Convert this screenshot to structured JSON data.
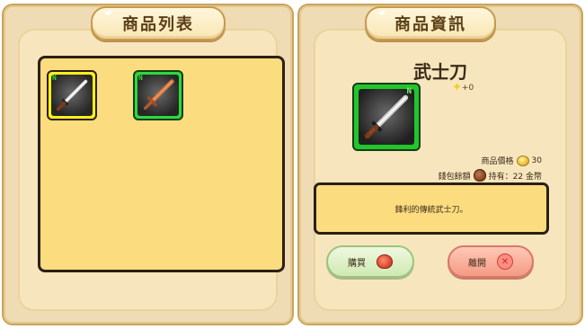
{
  "shop_list": {
    "title": "商品列表",
    "items": [
      {
        "tag": "N",
        "frame_color": "#ffef1a"
      },
      {
        "tag": "N",
        "frame_color": "#2fd83a"
      }
    ]
  },
  "shop_info": {
    "title": "商品資訊",
    "item_name": "武士刀",
    "item_tag": "N",
    "upgrade_level": "+0",
    "price_label": "商品價格",
    "price_value": "30",
    "wallet_label": "錢包餘額",
    "wallet_value": "持有：22 金幣",
    "description": "鋒利的傳統武士刀。",
    "buy_label": "購買",
    "leave_label": "離開"
  },
  "icons": {
    "coin": "coin-icon",
    "wallet": "bag-icon",
    "buy": "purse-icon",
    "leave": "close-icon",
    "upgrade": "sparkle-icon"
  }
}
